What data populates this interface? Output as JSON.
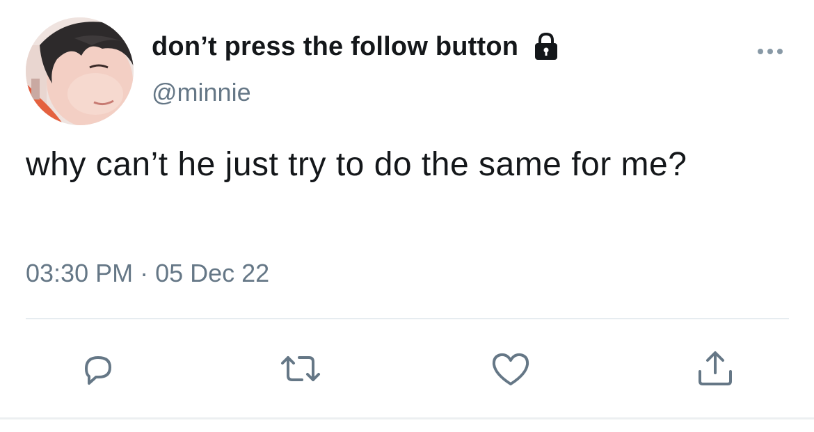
{
  "tweet": {
    "display_name": "don’t press the follow button",
    "handle": "@minnie",
    "text": "why can’t he just try to do the same for me?",
    "time": "03:30 PM",
    "separator": "·",
    "date": "05 Dec 22",
    "protected_icon": "lock-icon",
    "more_icon": "more-horizontal-icon"
  },
  "actions": [
    {
      "name": "reply",
      "icon": "comment-icon"
    },
    {
      "name": "retweet",
      "icon": "retweet-icon"
    },
    {
      "name": "like",
      "icon": "heart-icon"
    },
    {
      "name": "share",
      "icon": "share-icon"
    }
  ],
  "colors": {
    "text": "#14171a",
    "secondary": "#657786",
    "divider": "#e6ecf0",
    "icon": "#657786"
  }
}
